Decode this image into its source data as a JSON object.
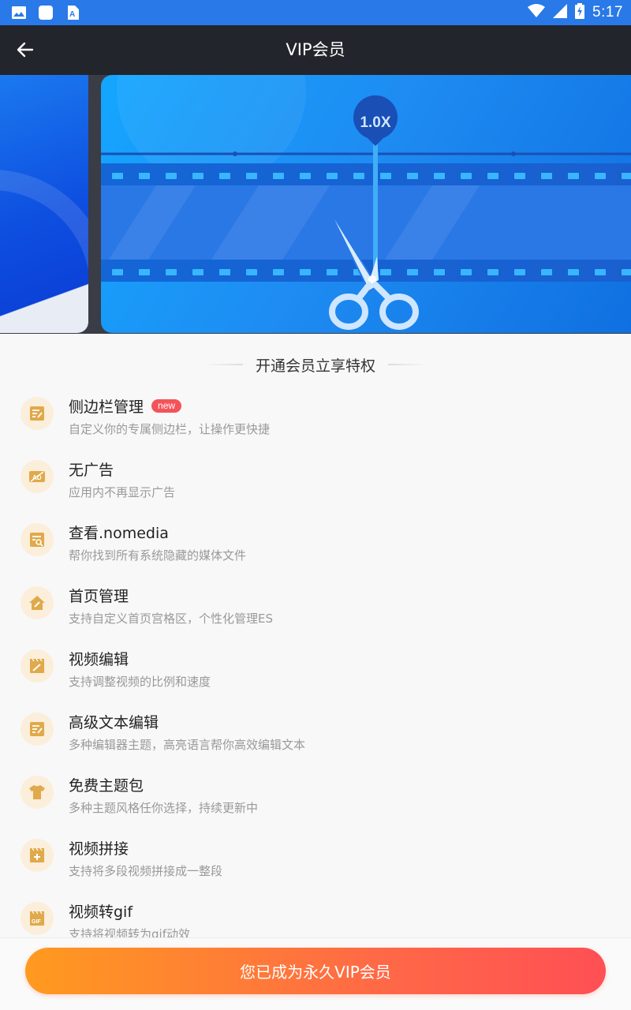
{
  "status_bar": {
    "time": "5:17",
    "left_icons": [
      "image-icon",
      "sd-card-icon",
      "font-icon"
    ],
    "right_icons": [
      "wifi-icon",
      "signal-icon",
      "battery-charging-icon"
    ]
  },
  "app_bar": {
    "title": "VIP会员",
    "back_icon": "arrow-left-icon"
  },
  "banner": {
    "speed_label": "1.0X"
  },
  "section": {
    "title": "开通会员立享特权"
  },
  "features": [
    {
      "title": "侧边栏管理",
      "badge": "new",
      "desc": "自定义你的专属侧边栏，让操作更快捷",
      "icon": "sidebar-edit-icon"
    },
    {
      "title": "无广告",
      "badge": "",
      "desc": "应用内不再显示广告",
      "icon": "no-ad-icon"
    },
    {
      "title": "查看.nomedia",
      "badge": "",
      "desc": "帮你找到所有系统隐藏的媒体文件",
      "icon": "search-file-icon"
    },
    {
      "title": "首页管理",
      "badge": "",
      "desc": "支持自定义首页宫格区，个性化管理ES",
      "icon": "home-edit-icon"
    },
    {
      "title": "视频编辑",
      "badge": "",
      "desc": "支持调整视频的比例和速度",
      "icon": "video-edit-icon"
    },
    {
      "title": "高级文本编辑",
      "badge": "",
      "desc": "多种编辑器主题，高亮语言帮你高效编辑文本",
      "icon": "text-edit-icon"
    },
    {
      "title": "免费主题包",
      "badge": "",
      "desc": "多种主题风格任你选择，持续更新中",
      "icon": "tshirt-icon"
    },
    {
      "title": "视频拼接",
      "badge": "",
      "desc": "支持将多段视频拼接成一整段",
      "icon": "video-merge-icon"
    },
    {
      "title": "视频转gif",
      "badge": "",
      "desc": "支持将视频转为gif动效",
      "icon": "gif-icon"
    }
  ],
  "bottom": {
    "button_label": "您已成为永久VIP会员"
  },
  "colors": {
    "status_bar": "#2979e8",
    "app_bar": "#23252c",
    "icon_bg": "#fbeedb",
    "icon_fg": "#e0a94a",
    "badge": "#f4535a",
    "button_start": "#ff9a1f",
    "button_end": "#ff4f55"
  }
}
